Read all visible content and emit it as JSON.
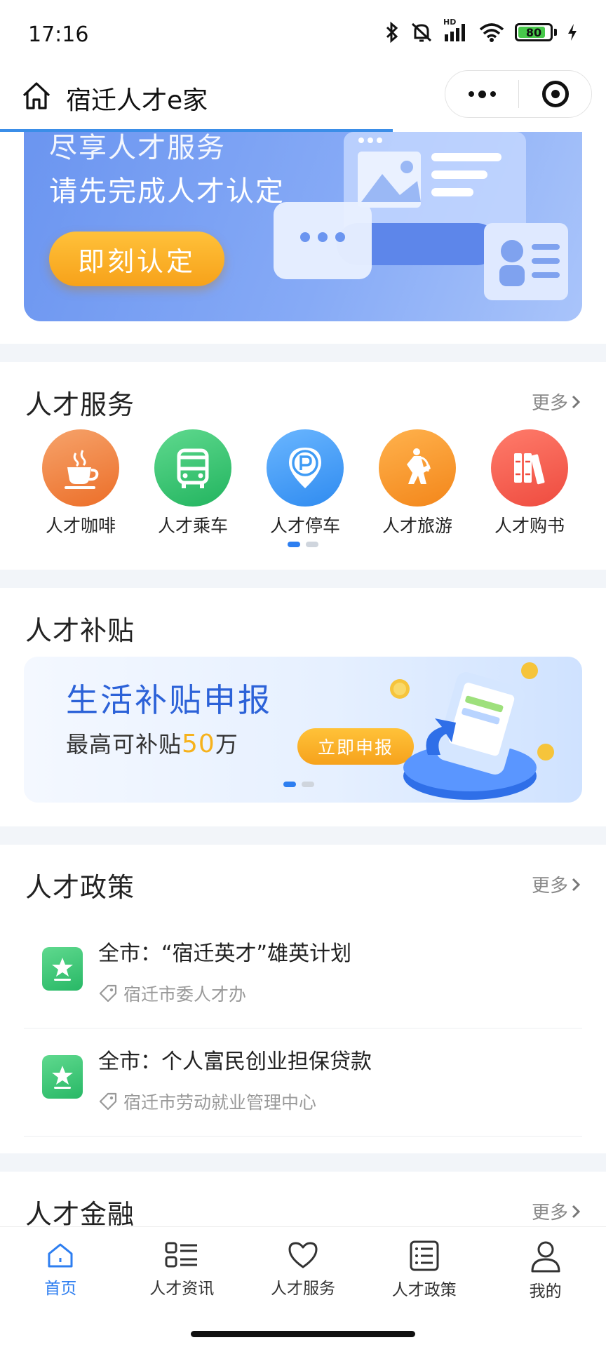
{
  "status_bar": {
    "time": "17:16",
    "battery": "80",
    "network_badge": "HD"
  },
  "nav": {
    "title": "宿迁人才e家"
  },
  "hero": {
    "line1": "尽享人才服务",
    "line2": "请先完成人才认定",
    "button": "即刻认定"
  },
  "services": {
    "title": "人才服务",
    "more": "更多",
    "items": [
      {
        "label": "人才咖啡",
        "icon": "coffee-icon",
        "color": "#f0823a"
      },
      {
        "label": "人才乘车",
        "icon": "bus-icon",
        "color": "#35c76d"
      },
      {
        "label": "人才停车",
        "icon": "parking-icon",
        "color": "#3f9bf5"
      },
      {
        "label": "人才旅游",
        "icon": "travel-icon",
        "color": "#f59422"
      },
      {
        "label": "人才购书",
        "icon": "books-icon",
        "color": "#f45a4f"
      }
    ]
  },
  "subsidy": {
    "title": "人才补贴",
    "card_title": "生活补贴申报",
    "desc_prefix": "最高可补贴",
    "desc_amount": "50",
    "desc_unit": "万",
    "button": "立即申报"
  },
  "policy": {
    "title": "人才政策",
    "more": "更多",
    "items": [
      {
        "title": "全市：“宿迁英才”雄英计划",
        "source": "宿迁市委人才办"
      },
      {
        "title": "全市：个人富民创业担保贷款",
        "source": "宿迁市劳动就业管理中心"
      }
    ]
  },
  "finance": {
    "title": "人才金融",
    "more": "更多"
  },
  "tabbar": {
    "items": [
      {
        "label": "首页",
        "active": true
      },
      {
        "label": "人才资讯",
        "active": false
      },
      {
        "label": "人才服务",
        "active": false
      },
      {
        "label": "人才政策",
        "active": false
      },
      {
        "label": "我的",
        "active": false
      }
    ]
  },
  "colors": {
    "accent": "#2d7ef0",
    "orange": "#f7a21a"
  }
}
